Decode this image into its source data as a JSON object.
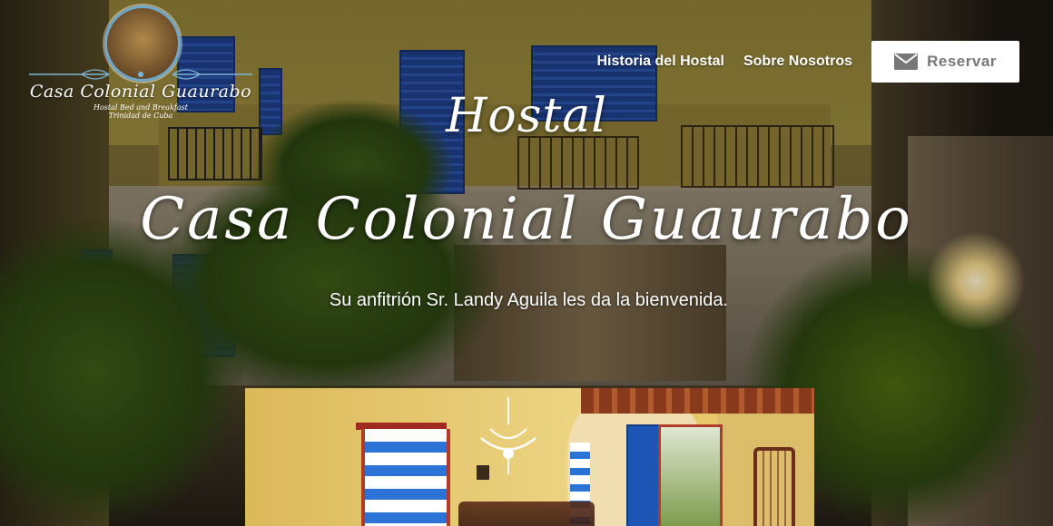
{
  "logo": {
    "name": "Casa Colonial Guaurabo",
    "tagline_1": "Hostal Bed and Breakfast",
    "tagline_2": "Trinidad de Cuba"
  },
  "nav": {
    "links": [
      {
        "label": "Historia del Hostal"
      },
      {
        "label": "Sobre Nosotros"
      }
    ],
    "cta_label": "Reservar",
    "cta_icon": "mail-icon"
  },
  "hero": {
    "title_line_1": "Hostal",
    "title_line_2": "Casa Colonial Guaurabo",
    "subtitle": "Su anfitrión Sr. Landy Aguila les da la bienvenida."
  },
  "colors": {
    "text_light": "#ffffff",
    "button_bg": "#ffffff",
    "button_text": "#777777"
  }
}
